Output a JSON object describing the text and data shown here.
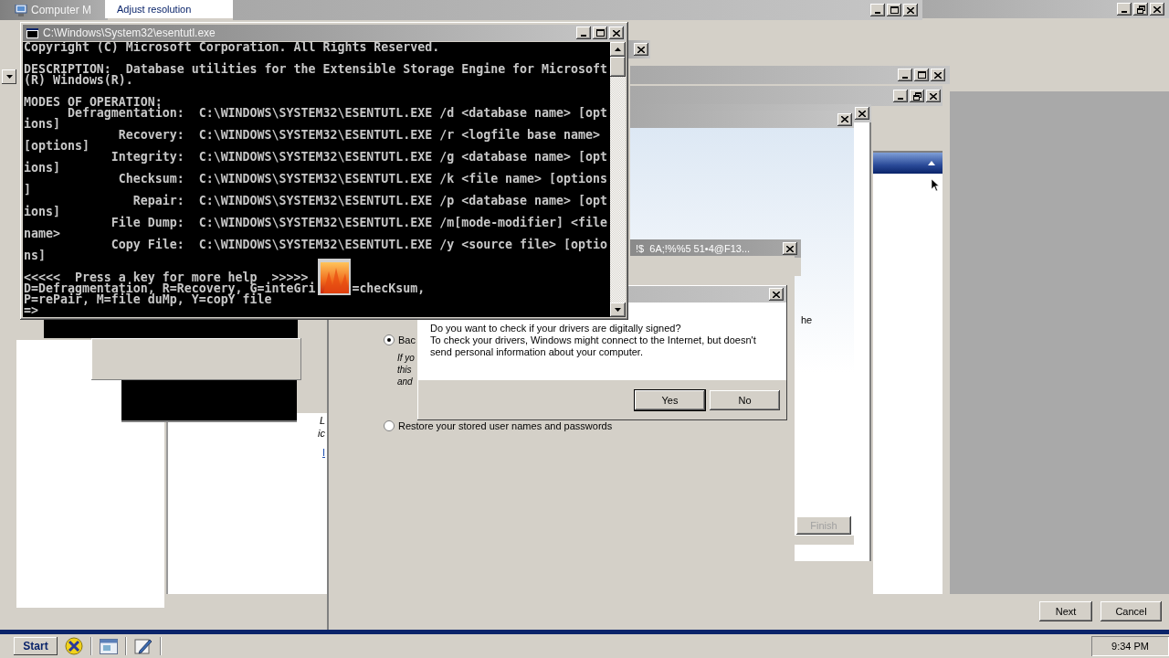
{
  "top_window": {
    "title": "Computer M"
  },
  "resolution_tab": {
    "label": "Adjust resolution"
  },
  "back_windows": [
    {
      "controls": [
        {
          "kind": "minimize"
        },
        {
          "kind": "maximize"
        },
        {
          "kind": "close"
        }
      ]
    },
    {
      "controls": [
        {
          "kind": "minimize"
        },
        {
          "kind": "restore"
        },
        {
          "kind": "close"
        }
      ]
    },
    {
      "controls": [
        {
          "kind": "close"
        }
      ]
    },
    {
      "controls": [
        {
          "kind": "minimize"
        },
        {
          "kind": "maximize"
        },
        {
          "kind": "close"
        }
      ]
    },
    {
      "controls": [
        {
          "kind": "minimize"
        },
        {
          "kind": "restore"
        },
        {
          "kind": "close"
        }
      ]
    },
    {
      "controls": [
        {
          "kind": "close"
        }
      ]
    },
    {
      "controls": [
        {
          "kind": "close"
        }
      ],
      "side_text": "he",
      "button": {
        "label": "Finish",
        "disabled": true
      }
    },
    {
      "title": "!$  6A;!%%5 51•4@F13...",
      "controls": [
        {
          "kind": "close"
        }
      ]
    }
  ],
  "console": {
    "title": "C:\\Windows\\System32\\esentutl.exe",
    "copyright": "Copyright (C) Microsoft Corporation. All Rights Reserved.",
    "description": [
      "DESCRIPTION:  Database utilities for the Extensible Storage Engine for Microsoft",
      "(R) Windows(R)."
    ],
    "modes_heading": "MODES OF OPERATION:",
    "modes": [
      {
        "label": "Defragmentation:",
        "command": "C:\\WINDOWS\\SYSTEM32\\ESENTUTL.EXE /d <database name> [opt",
        "overflow": "ions]"
      },
      {
        "label": "Recovery:",
        "command": "C:\\WINDOWS\\SYSTEM32\\ESENTUTL.EXE /r <logfile base name>",
        "overflow": "[options]"
      },
      {
        "label": "Integrity:",
        "command": "C:\\WINDOWS\\SYSTEM32\\ESENTUTL.EXE /g <database name> [opt",
        "overflow": "ions]"
      },
      {
        "label": "Checksum:",
        "command": "C:\\WINDOWS\\SYSTEM32\\ESENTUTL.EXE /k <file name> [options",
        "overflow": "]"
      },
      {
        "label": "Repair:",
        "command": "C:\\WINDOWS\\SYSTEM32\\ESENTUTL.EXE /p <database name> [opt",
        "overflow": "ions]"
      },
      {
        "label": "File Dump:",
        "command": "C:\\WINDOWS\\SYSTEM32\\ESENTUTL.EXE /m[mode-modifier] <file",
        "overflow": "name>"
      },
      {
        "label": "Copy File:",
        "command": "C:\\WINDOWS\\SYSTEM32\\ESENTUTL.EXE /y <source file> [optio",
        "overflow": "ns]"
      }
    ],
    "help": "<<<<<  Press a key for more help  >>>>>",
    "keys": [
      [
        "D=Defragmentation, R=Recovery, G=inteGri",
        "=checKsum,"
      ],
      [
        "P=rePair, M=file duMp, Y=copY file"
      ]
    ],
    "prompt": "=>"
  },
  "left_panes": {
    "fragments": [
      "L",
      "ic"
    ],
    "link": "I"
  },
  "wizard": {
    "options": [
      {
        "label": "Bac",
        "selected": true,
        "description": [
          "If yo",
          "this",
          "and"
        ]
      },
      {
        "label": "Restore your stored user names and passwords",
        "selected": false
      }
    ],
    "buttons": [
      "Next",
      "Cancel"
    ]
  },
  "driver_dialog": {
    "question": "Do you want to check if your drivers are digitally signed?",
    "detail": "To check your drivers, Windows might connect to the Internet, but doesn't send personal information about your computer.",
    "buttons": [
      {
        "label": "Yes",
        "default": true
      },
      {
        "label": "No",
        "default": false
      }
    ]
  },
  "taskbar": {
    "start": "Start",
    "clock": "9:34 PM"
  }
}
